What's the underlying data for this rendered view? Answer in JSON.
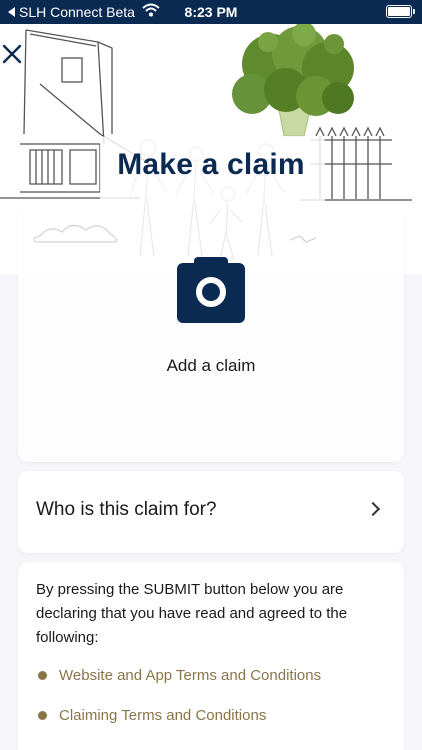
{
  "status_bar": {
    "back_app": "SLH Connect Beta",
    "time": "8:23 PM"
  },
  "header": {
    "title": "Make a claim"
  },
  "claim_card": {
    "label": "Add a claim",
    "icon": "camera-icon"
  },
  "who_card": {
    "label": "Who is this claim for?"
  },
  "terms_card": {
    "text": "By pressing the SUBMIT button below you are declaring that you have read and agreed to the following:",
    "links": [
      "Website and App Terms and Conditions",
      "Claiming Terms and Conditions"
    ]
  },
  "colors": {
    "brand_navy": "#0b2a52",
    "link_gold": "#8a7548",
    "background": "#f5f5fa"
  }
}
